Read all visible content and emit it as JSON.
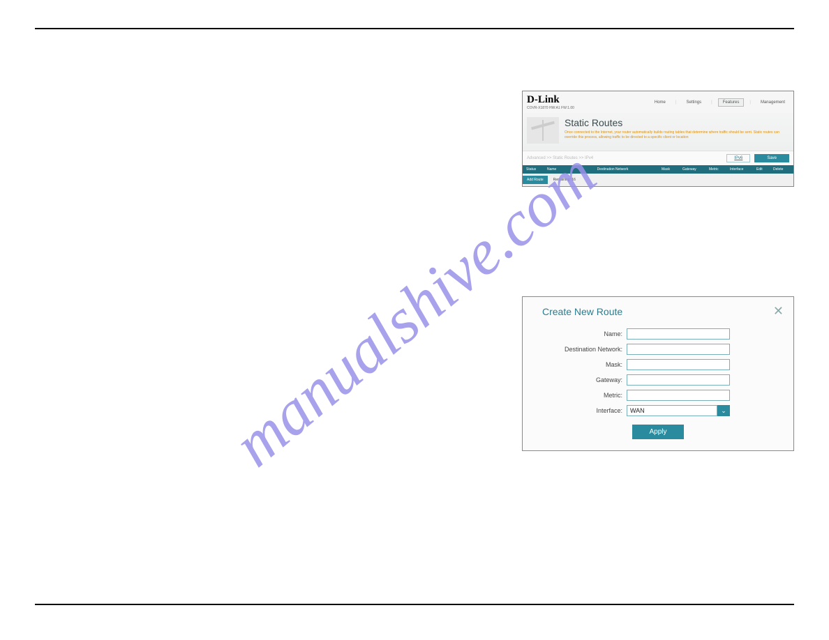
{
  "watermark": "manualshive.com",
  "shot1": {
    "logo": "D-Link",
    "model": "COVR-X1870 HW:A1 FW:1.00",
    "nav": {
      "home": "Home",
      "settings": "Settings",
      "features": "Features",
      "management": "Management"
    },
    "hero_title": "Static Routes",
    "hero_body": "Once connected to the Internet, your router automatically builds routing tables that determine where traffic should be sent. Static routes can override this process, allowing traffic to be directed to a specific client or location",
    "crumb": "Advanced >> Static Routes >> IPv4",
    "ipv6_btn": "IPv6",
    "save_btn": "Save",
    "cols": {
      "status": "Status",
      "name": "Name",
      "dest": "Destination Network",
      "mask": "Mask",
      "gateway": "Gateway",
      "metric": "Metric",
      "interface": "Interface",
      "edit": "Edit",
      "delete": "Delete"
    },
    "add_btn": "Add Route",
    "remaining": "Remaining: 16"
  },
  "shot2": {
    "title": "Create New Route",
    "labels": {
      "name": "Name:",
      "dest": "Destination Network:",
      "mask": "Mask:",
      "gateway": "Gateway:",
      "metric": "Metric:",
      "interface": "Interface:"
    },
    "interface_value": "WAN",
    "apply": "Apply"
  }
}
